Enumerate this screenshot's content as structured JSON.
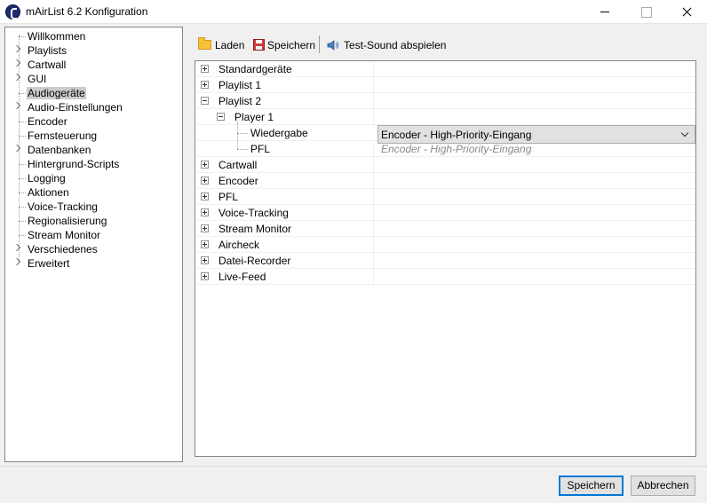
{
  "window": {
    "title": "mAirList 6.2 Konfiguration"
  },
  "nav": {
    "items": [
      {
        "label": "Willkommen",
        "expandable": false
      },
      {
        "label": "Playlists",
        "expandable": true
      },
      {
        "label": "Cartwall",
        "expandable": true
      },
      {
        "label": "GUI",
        "expandable": true
      },
      {
        "label": "Audiogeräte",
        "expandable": false,
        "selected": true
      },
      {
        "label": "Audio-Einstellungen",
        "expandable": true
      },
      {
        "label": "Encoder",
        "expandable": false
      },
      {
        "label": "Fernsteuerung",
        "expandable": false
      },
      {
        "label": "Datenbanken",
        "expandable": true
      },
      {
        "label": "Hintergrund-Scripts",
        "expandable": false
      },
      {
        "label": "Logging",
        "expandable": false
      },
      {
        "label": "Aktionen",
        "expandable": false
      },
      {
        "label": "Voice-Tracking",
        "expandable": false
      },
      {
        "label": "Regionalisierung",
        "expandable": false
      },
      {
        "label": "Stream Monitor",
        "expandable": false
      },
      {
        "label": "Verschiedenes",
        "expandable": true
      },
      {
        "label": "Erweitert",
        "expandable": true
      }
    ]
  },
  "toolbar": {
    "load_label": "Laden",
    "save_label": "Speichern",
    "test_sound_label": "Test-Sound abspielen"
  },
  "tree": {
    "standardgeraete": "Standardgeräte",
    "playlist1": "Playlist 1",
    "playlist2": "Playlist 2",
    "player1": "Player 1",
    "wiedergabe": "Wiedergabe",
    "wiedergabe_value": "Encoder - High-Priority-Eingang",
    "pfl": "PFL",
    "pfl_value": "Encoder - High-Priority-Eingang",
    "cartwall": "Cartwall",
    "encoder": "Encoder",
    "pfl_top": "PFL",
    "voice_tracking": "Voice-Tracking",
    "stream_monitor": "Stream Monitor",
    "aircheck": "Aircheck",
    "datei_recorder": "Datei-Recorder",
    "live_feed": "Live-Feed"
  },
  "buttons": {
    "save": "Speichern",
    "cancel": "Abbrechen"
  }
}
